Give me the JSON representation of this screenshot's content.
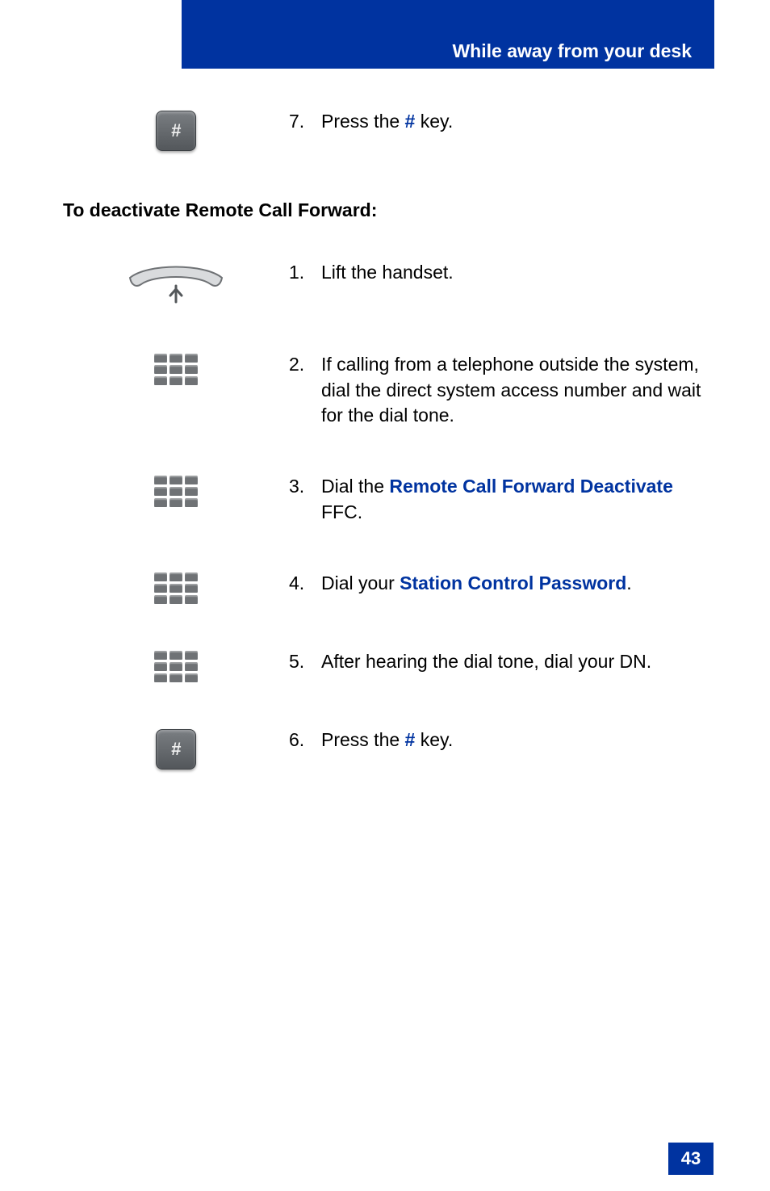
{
  "header": {
    "title": "While away from your desk"
  },
  "top_step": {
    "num": "7.",
    "prefix": "Press the ",
    "kw": "#",
    "suffix": " key."
  },
  "section_heading": "To deactivate Remote Call Forward:",
  "steps": [
    {
      "icon": "handset",
      "num": "1.",
      "segments": [
        {
          "t": "Lift the handset."
        }
      ]
    },
    {
      "icon": "keypad",
      "num": "2.",
      "segments": [
        {
          "t": "If calling from a telephone outside the system, dial the direct system access number and wait for the dial tone."
        }
      ]
    },
    {
      "icon": "keypad",
      "num": "3.",
      "segments": [
        {
          "t": "Dial the "
        },
        {
          "t": "Remote Call Forward Deactivate",
          "kw": true
        },
        {
          "t": " FFC."
        }
      ]
    },
    {
      "icon": "keypad",
      "num": "4.",
      "segments": [
        {
          "t": "Dial your "
        },
        {
          "t": "Station Control Password",
          "kw": true
        },
        {
          "t": "."
        }
      ]
    },
    {
      "icon": "keypad",
      "num": "5.",
      "segments": [
        {
          "t": "After hearing the dial tone, dial your DN."
        }
      ]
    },
    {
      "icon": "hashkey",
      "num": "6.",
      "segments": [
        {
          "t": "Press the "
        },
        {
          "t": "#",
          "kw": true
        },
        {
          "t": " key."
        }
      ]
    }
  ],
  "page_number": "43",
  "hash_glyph": "#"
}
